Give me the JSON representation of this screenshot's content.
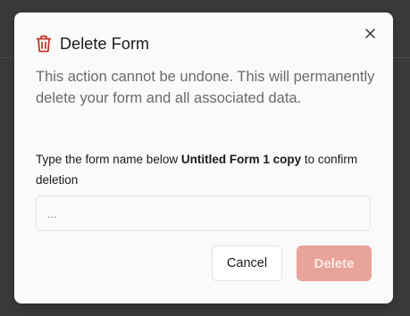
{
  "dialog": {
    "title": "Delete Form",
    "description": "This action cannot be undone. This will permanently delete your form and all associated data.",
    "instruction_prefix": "Type the form name below ",
    "form_name": "Untitled Form 1 copy",
    "instruction_suffix": " to confirm deletion",
    "input": {
      "value": "",
      "placeholder": "..."
    },
    "cancel_label": "Cancel",
    "delete_label": "Delete"
  },
  "icons": {
    "title_icon": "trash-icon",
    "close_icon": "close-icon"
  },
  "colors": {
    "destructive": "#c0392b",
    "delete_button_disabled_bg": "#e8a39a",
    "backdrop": "#3b3b3b",
    "dialog_bg": "#fafafa",
    "muted_text": "#6b6b6b"
  }
}
